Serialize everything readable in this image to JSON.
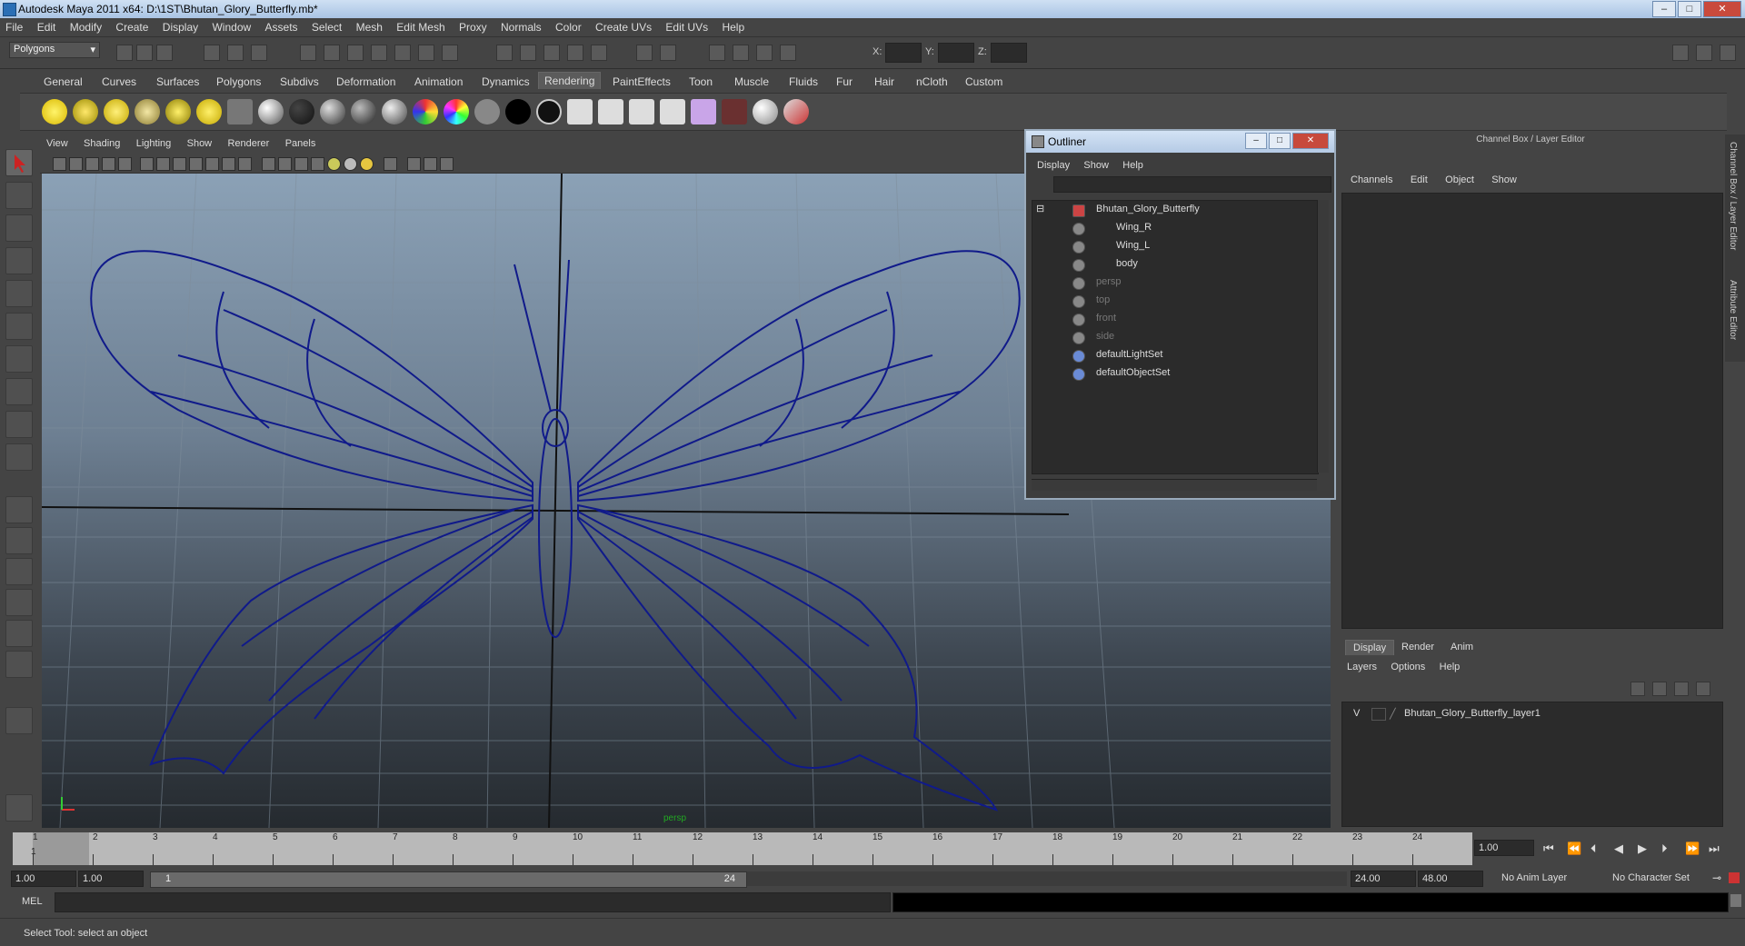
{
  "window": {
    "title": "Autodesk Maya 2011 x64: D:\\1ST\\Bhutan_Glory_Butterfly.mb*"
  },
  "menubar": [
    "File",
    "Edit",
    "Modify",
    "Create",
    "Display",
    "Window",
    "Assets",
    "Select",
    "Mesh",
    "Edit Mesh",
    "Proxy",
    "Normals",
    "Color",
    "Create UVs",
    "Edit UVs",
    "Help"
  ],
  "statusline": {
    "mode": "Polygons",
    "x_label": "X:",
    "y_label": "Y:",
    "z_label": "Z:"
  },
  "shelf_tabs": [
    "General",
    "Curves",
    "Surfaces",
    "Polygons",
    "Subdivs",
    "Deformation",
    "Animation",
    "Dynamics",
    "Rendering",
    "PaintEffects",
    "Toon",
    "Muscle",
    "Fluids",
    "Fur",
    "Hair",
    "nCloth",
    "Custom"
  ],
  "shelf_active": "Rendering",
  "viewport_menu": [
    "View",
    "Shading",
    "Lighting",
    "Show",
    "Renderer",
    "Panels"
  ],
  "viewport": {
    "camera_label": "persp"
  },
  "outliner": {
    "title": "Outliner",
    "menu": [
      "Display",
      "Show",
      "Help"
    ],
    "items": [
      {
        "label": "Bhutan_Glory_Butterfly",
        "dim": false
      },
      {
        "label": "Wing_R",
        "dim": false
      },
      {
        "label": "Wing_L",
        "dim": false
      },
      {
        "label": "body",
        "dim": false
      },
      {
        "label": "persp",
        "dim": true
      },
      {
        "label": "top",
        "dim": true
      },
      {
        "label": "front",
        "dim": true
      },
      {
        "label": "side",
        "dim": true
      },
      {
        "label": "defaultLightSet",
        "dim": false
      },
      {
        "label": "defaultObjectSet",
        "dim": false
      }
    ]
  },
  "channelbox": {
    "header": "Channel Box / Layer Editor",
    "menu": [
      "Channels",
      "Edit",
      "Object",
      "Show"
    ],
    "side_tabs": [
      "Channel Box / Layer Editor",
      "Attribute Editor"
    ]
  },
  "layers": {
    "tabs": [
      "Display",
      "Render",
      "Anim"
    ],
    "active_tab": "Display",
    "menu": [
      "Layers",
      "Options",
      "Help"
    ],
    "rows": [
      {
        "visible": "V",
        "name": "Bhutan_Glory_Butterfly_layer1"
      }
    ]
  },
  "timeslider": {
    "ticks": [
      "1",
      "2",
      "3",
      "4",
      "5",
      "6",
      "7",
      "8",
      "9",
      "10",
      "11",
      "12",
      "13",
      "14",
      "15",
      "16",
      "17",
      "18",
      "19",
      "20",
      "21",
      "22",
      "23",
      "24"
    ],
    "current_frame": "1",
    "current_time_field": "1.00"
  },
  "rangeslider": {
    "start_time": "1.00",
    "playback_start": "1.00",
    "range_start": "1",
    "range_end": "24",
    "playback_end": "24.00",
    "end_time": "48.00",
    "anim_layer": "No Anim Layer",
    "character_set": "No Character Set"
  },
  "cmdline": {
    "label": "MEL"
  },
  "helpline": {
    "text": "Select Tool: select an object"
  },
  "colors": {
    "wireframe": "#101a8a",
    "active_tab": "#5b5b5b",
    "outliner_border": "#99aabb"
  }
}
